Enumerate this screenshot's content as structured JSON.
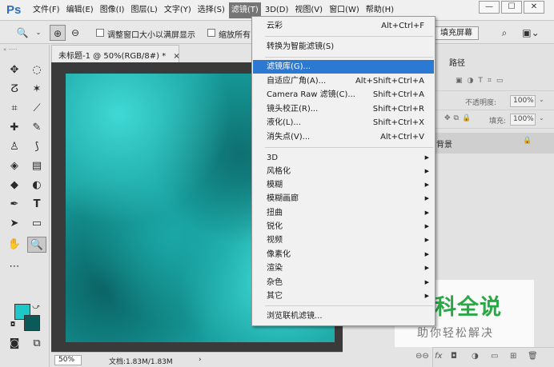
{
  "app": {
    "logo": "Ps"
  },
  "menubar": {
    "items": [
      "文件(F)",
      "编辑(E)",
      "图像(I)",
      "图层(L)",
      "文字(Y)",
      "选择(S)",
      "滤镜(T)",
      "3D(D)",
      "视图(V)",
      "窗口(W)",
      "帮助(H)"
    ],
    "active": "滤镜(T)"
  },
  "window_controls": {
    "minimize": "—",
    "maximize": "☐",
    "close": "✕"
  },
  "options_bar": {
    "resize_windows_label": "调整窗口大小以满屏显示",
    "zoom_all_label": "缩放所有",
    "fill_screen_label": "填充屏幕"
  },
  "document": {
    "tab_title": "未标题-1 @ 50%(RGB/8#) *",
    "tab_close": "×",
    "zoom": "50%",
    "doc_size": "文档:1.83M/1.83M",
    "status_arrow": "›"
  },
  "colors": {
    "foreground": "#1ec8c8",
    "background": "#0b5a5a",
    "menu_highlight": "#2c79d3"
  },
  "right_panel": {
    "tab_paths": "路径",
    "opacity_label": "不透明度:",
    "opacity_value": "100%",
    "fill_label": "填充:",
    "fill_value": "100%",
    "layer_name": "背景",
    "lock_icon": "🔒"
  },
  "filter_menu": {
    "items": [
      {
        "label": "云彩",
        "shortcut": "Alt+Ctrl+F"
      },
      {
        "label": "转换为智能滤镜(S)",
        "shortcut": ""
      },
      {
        "label": "滤镜库(G)...",
        "shortcut": "",
        "highlighted": true
      },
      {
        "label": "自适应广角(A)...",
        "shortcut": "Alt+Shift+Ctrl+A"
      },
      {
        "label": "Camera Raw 滤镜(C)...",
        "shortcut": "Shift+Ctrl+A"
      },
      {
        "label": "镜头校正(R)...",
        "shortcut": "Shift+Ctrl+R"
      },
      {
        "label": "液化(L)...",
        "shortcut": "Shift+Ctrl+X"
      },
      {
        "label": "消失点(V)...",
        "shortcut": "Alt+Ctrl+V"
      },
      {
        "label": "3D",
        "submenu": true
      },
      {
        "label": "风格化",
        "submenu": true
      },
      {
        "label": "模糊",
        "submenu": true
      },
      {
        "label": "模糊画廊",
        "submenu": true
      },
      {
        "label": "扭曲",
        "submenu": true
      },
      {
        "label": "锐化",
        "submenu": true
      },
      {
        "label": "视频",
        "submenu": true
      },
      {
        "label": "像素化",
        "submenu": true
      },
      {
        "label": "渲染",
        "submenu": true
      },
      {
        "label": "杂色",
        "submenu": true
      },
      {
        "label": "其它",
        "submenu": true
      },
      {
        "label": "浏览联机滤镜...",
        "shortcut": ""
      }
    ],
    "submenu_glyph": "▶"
  },
  "watermark": {
    "title": "百科全说",
    "subtitle": "助你轻松解决"
  }
}
